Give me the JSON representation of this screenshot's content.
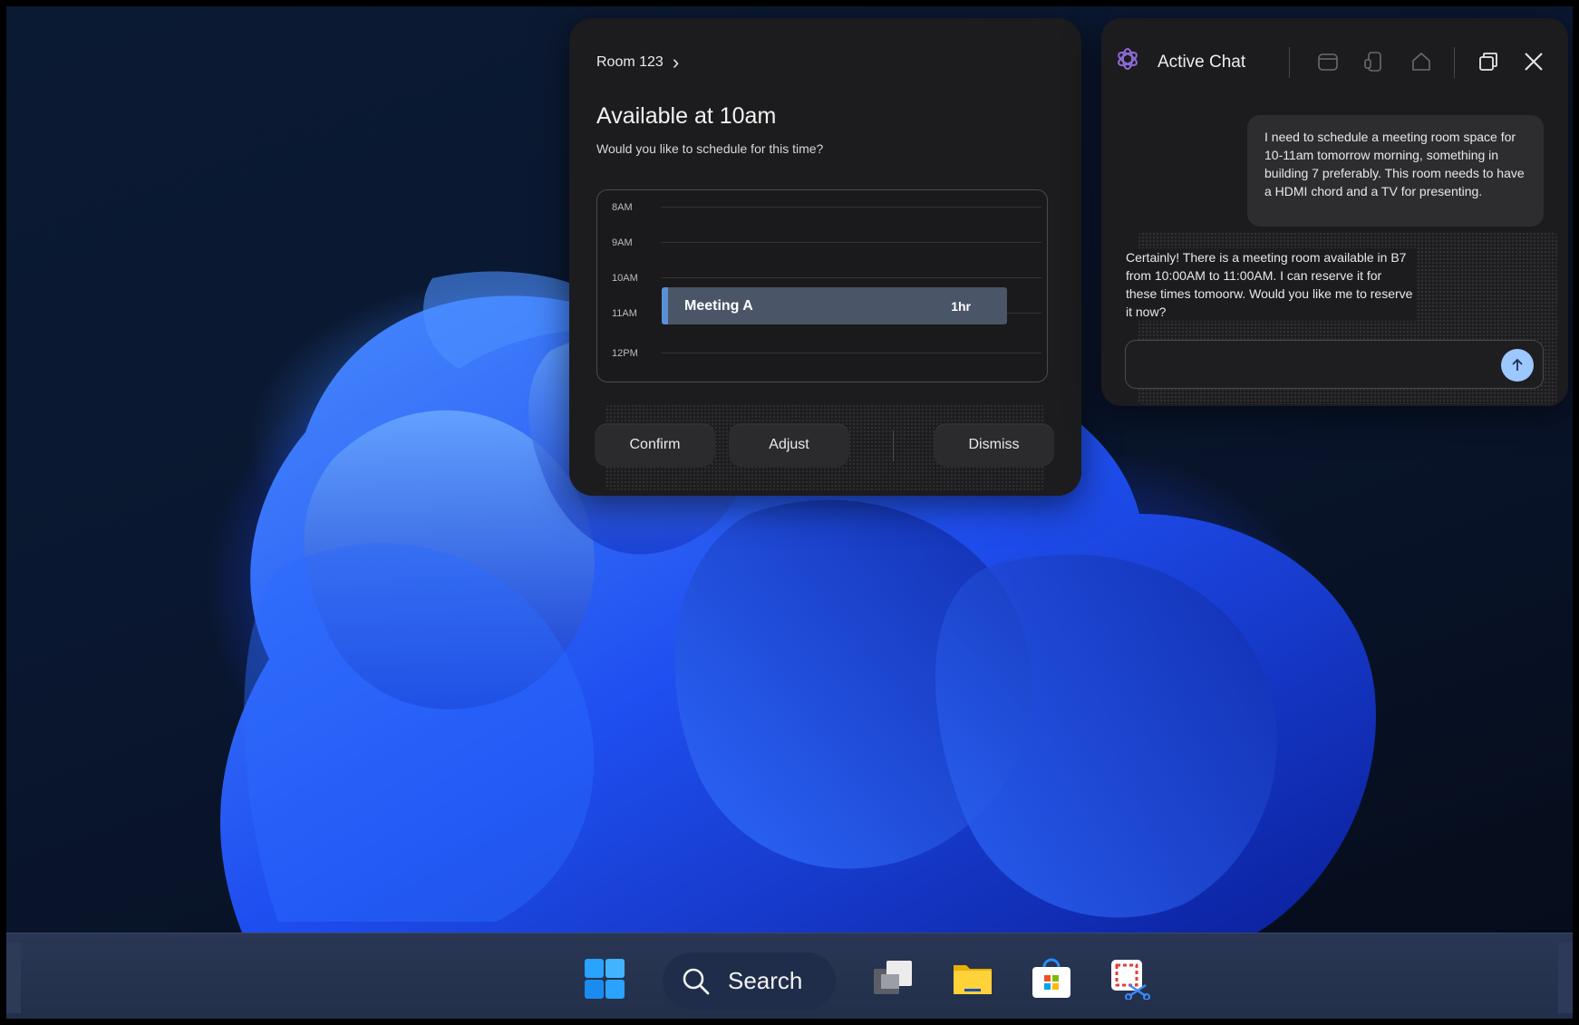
{
  "schedule_panel": {
    "room_label": "Room 123",
    "title": "Available at 10am",
    "question": "Would you like to schedule for this time?",
    "hours": [
      "8AM",
      "9AM",
      "10AM",
      "11AM",
      "12PM"
    ],
    "meeting": {
      "title": "Meeting A",
      "duration": "1hr"
    },
    "buttons": {
      "confirm": "Confirm",
      "adjust": "Adjust",
      "dismiss": "Dismiss"
    }
  },
  "chat_panel": {
    "title": "Active Chat",
    "user_message": "I need to schedule a meeting room space for 10-11am tomorrow morning, something in building 7 preferably. This room needs to have a HDMI chord and a TV for presenting.",
    "assistant_message": "Certainly! There is a meeting room available in B7 from 10:00AM to 11:00AM. I can reserve it for these times tomoorw. Would you like me to reserve it now?",
    "input_value": "",
    "header_icons": [
      "calendar-icon",
      "device-icon",
      "home-icon",
      "restore-window-icon",
      "close-icon"
    ]
  },
  "taskbar": {
    "search_label": "Search",
    "items": [
      "start-icon",
      "search",
      "task-view-icon",
      "file-explorer-icon",
      "store-icon",
      "snipping-tool-icon"
    ]
  },
  "colors": {
    "accent_send": "#9cc7ff",
    "meeting_block": "#4a5568",
    "meeting_accent": "#5b8fd6",
    "panel_bg": "#1c1c1e"
  }
}
